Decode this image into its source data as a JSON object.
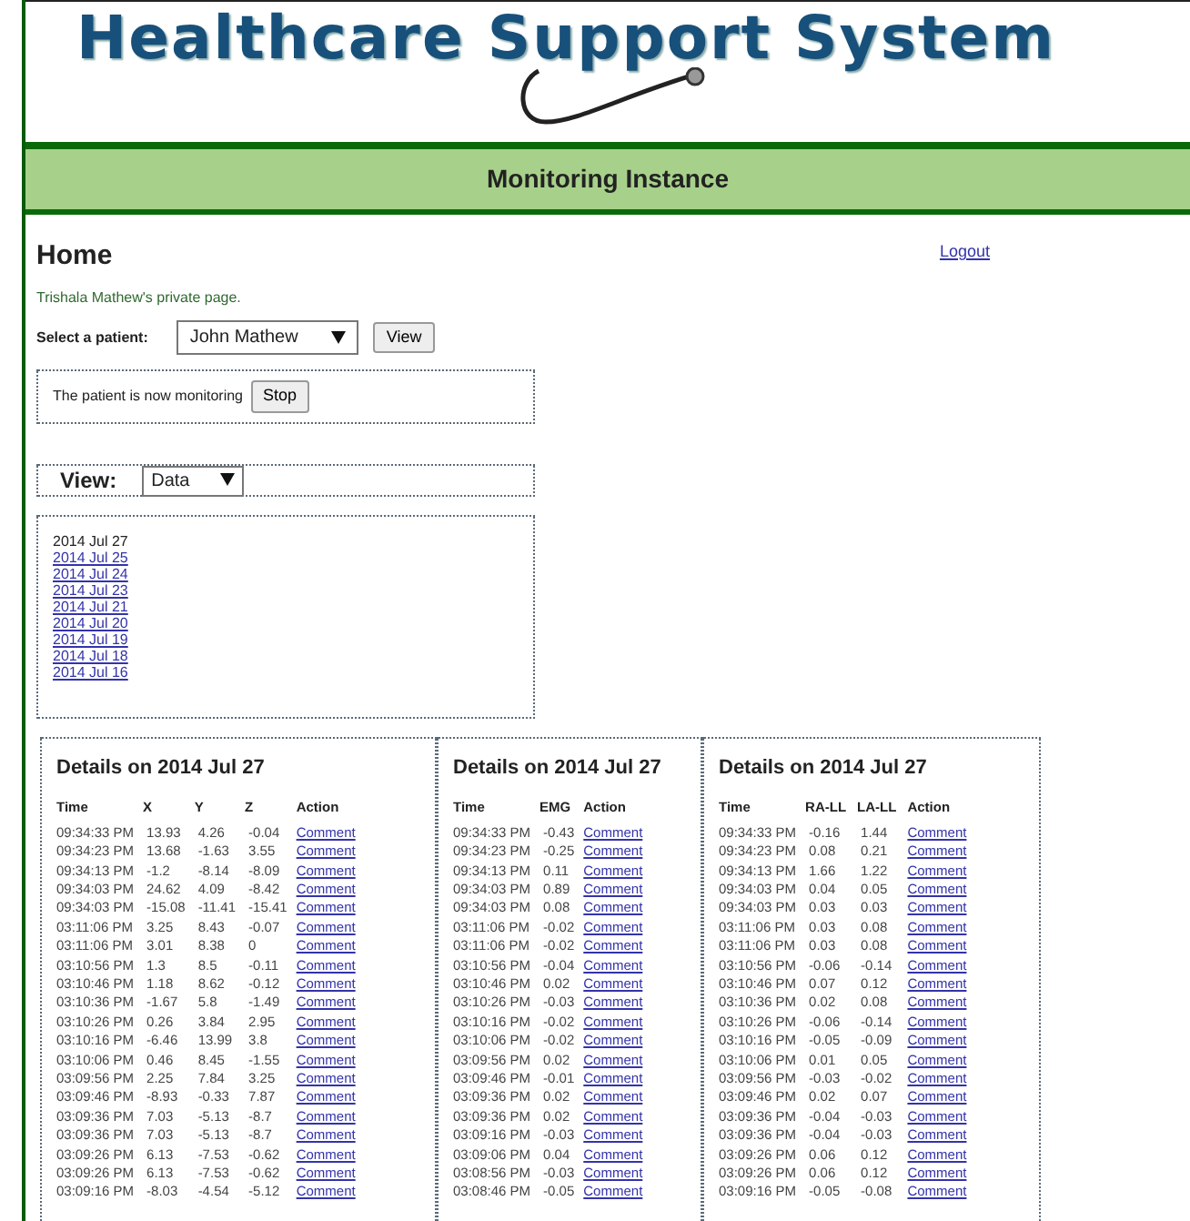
{
  "header": {
    "title": "Healthcare Support System"
  },
  "banner": {
    "title": "Monitoring Instance"
  },
  "page": {
    "heading": "Home",
    "logout": "Logout",
    "owner_note": "Trishala Mathew's private page.",
    "patient_select": {
      "label": "Select a patient:",
      "value": "John Mathew",
      "button": "View"
    },
    "monitoring": {
      "text": "The patient is now monitoring",
      "button": "Stop"
    },
    "view": {
      "label": "View:",
      "value": "Data"
    },
    "dates": [
      {
        "label": "2014 Jul 27",
        "selected": true
      },
      {
        "label": "2014 Jul 25",
        "selected": false
      },
      {
        "label": "2014 Jul 24",
        "selected": false
      },
      {
        "label": "2014 Jul 23",
        "selected": false
      },
      {
        "label": "2014 Jul 21",
        "selected": false
      },
      {
        "label": "2014 Jul 20",
        "selected": false
      },
      {
        "label": "2014 Jul 19",
        "selected": false
      },
      {
        "label": "2014 Jul 18",
        "selected": false
      },
      {
        "label": "2014 Jul 16",
        "selected": false
      }
    ]
  },
  "tables": [
    {
      "title": "Details on 2014 Jul 27",
      "columns": [
        {
          "label": "Time",
          "kind": "time"
        },
        {
          "label": "X",
          "kind": "num"
        },
        {
          "label": "Y",
          "kind": "num"
        },
        {
          "label": "Z",
          "kind": "num"
        },
        {
          "label": "Action",
          "kind": "link"
        }
      ],
      "rows": [
        [
          "09:34:33 PM",
          "13.93",
          "4.26",
          "-0.04",
          "Comment"
        ],
        [
          "09:34:23 PM",
          "13.68",
          "-1.63",
          "3.55",
          "Comment"
        ],
        [
          "09:34:13 PM",
          "-1.2",
          "-8.14",
          "-8.09",
          "Comment"
        ],
        [
          "09:34:03 PM",
          "24.62",
          "4.09",
          "-8.42",
          "Comment"
        ],
        [
          "09:34:03 PM",
          "-15.08",
          "-11.41",
          "-15.41",
          "Comment"
        ],
        [
          "03:11:06 PM",
          "3.25",
          "8.43",
          "-0.07",
          "Comment"
        ],
        [
          "03:11:06 PM",
          "3.01",
          "8.38",
          "0",
          "Comment"
        ],
        [
          "03:10:56 PM",
          "1.3",
          "8.5",
          "-0.11",
          "Comment"
        ],
        [
          "03:10:46 PM",
          "1.18",
          "8.62",
          "-0.12",
          "Comment"
        ],
        [
          "03:10:36 PM",
          "-1.67",
          "5.8",
          "-1.49",
          "Comment"
        ],
        [
          "03:10:26 PM",
          "0.26",
          "3.84",
          "2.95",
          "Comment"
        ],
        [
          "03:10:16 PM",
          "-6.46",
          "13.99",
          "3.8",
          "Comment"
        ],
        [
          "03:10:06 PM",
          "0.46",
          "8.45",
          "-1.55",
          "Comment"
        ],
        [
          "03:09:56 PM",
          "2.25",
          "7.84",
          "3.25",
          "Comment"
        ],
        [
          "03:09:46 PM",
          "-8.93",
          "-0.33",
          "7.87",
          "Comment"
        ],
        [
          "03:09:36 PM",
          "7.03",
          "-5.13",
          "-8.7",
          "Comment"
        ],
        [
          "03:09:36 PM",
          "7.03",
          "-5.13",
          "-8.7",
          "Comment"
        ],
        [
          "03:09:26 PM",
          "6.13",
          "-7.53",
          "-0.62",
          "Comment"
        ],
        [
          "03:09:26 PM",
          "6.13",
          "-7.53",
          "-0.62",
          "Comment"
        ],
        [
          "03:09:16 PM",
          "-8.03",
          "-4.54",
          "-5.12",
          "Comment"
        ]
      ]
    },
    {
      "title": "Details on 2014 Jul 27",
      "columns": [
        {
          "label": "Time",
          "kind": "time"
        },
        {
          "label": "EMG",
          "kind": "num"
        },
        {
          "label": "Action",
          "kind": "link"
        }
      ],
      "rows": [
        [
          "09:34:33 PM",
          "-0.43",
          "Comment"
        ],
        [
          "09:34:23 PM",
          "-0.25",
          "Comment"
        ],
        [
          "09:34:13 PM",
          "0.11",
          "Comment"
        ],
        [
          "09:34:03 PM",
          "0.89",
          "Comment"
        ],
        [
          "09:34:03 PM",
          "0.08",
          "Comment"
        ],
        [
          "03:11:06 PM",
          "-0.02",
          "Comment"
        ],
        [
          "03:11:06 PM",
          "-0.02",
          "Comment"
        ],
        [
          "03:10:56 PM",
          "-0.04",
          "Comment"
        ],
        [
          "03:10:46 PM",
          "0.02",
          "Comment"
        ],
        [
          "03:10:26 PM",
          "-0.03",
          "Comment"
        ],
        [
          "03:10:16 PM",
          "-0.02",
          "Comment"
        ],
        [
          "03:10:06 PM",
          "-0.02",
          "Comment"
        ],
        [
          "03:09:56 PM",
          "0.02",
          "Comment"
        ],
        [
          "03:09:46 PM",
          "-0.01",
          "Comment"
        ],
        [
          "03:09:36 PM",
          "0.02",
          "Comment"
        ],
        [
          "03:09:36 PM",
          "0.02",
          "Comment"
        ],
        [
          "03:09:16 PM",
          "-0.03",
          "Comment"
        ],
        [
          "03:09:06 PM",
          "0.04",
          "Comment"
        ],
        [
          "03:08:56 PM",
          "-0.03",
          "Comment"
        ],
        [
          "03:08:46 PM",
          "-0.05",
          "Comment"
        ]
      ]
    },
    {
      "title": "Details on 2014 Jul 27",
      "columns": [
        {
          "label": "Time",
          "kind": "time"
        },
        {
          "label": "RA-LL",
          "kind": "num"
        },
        {
          "label": "LA-LL",
          "kind": "num"
        },
        {
          "label": "Action",
          "kind": "link"
        }
      ],
      "rows": [
        [
          "09:34:33 PM",
          "-0.16",
          "1.44",
          "Comment"
        ],
        [
          "09:34:23 PM",
          "0.08",
          "0.21",
          "Comment"
        ],
        [
          "09:34:13 PM",
          "1.66",
          "1.22",
          "Comment"
        ],
        [
          "09:34:03 PM",
          "0.04",
          "0.05",
          "Comment"
        ],
        [
          "09:34:03 PM",
          "0.03",
          "0.03",
          "Comment"
        ],
        [
          "03:11:06 PM",
          "0.03",
          "0.08",
          "Comment"
        ],
        [
          "03:11:06 PM",
          "0.03",
          "0.08",
          "Comment"
        ],
        [
          "03:10:56 PM",
          "-0.06",
          "-0.14",
          "Comment"
        ],
        [
          "03:10:46 PM",
          "0.07",
          "0.12",
          "Comment"
        ],
        [
          "03:10:36 PM",
          "0.02",
          "0.08",
          "Comment"
        ],
        [
          "03:10:26 PM",
          "-0.06",
          "-0.14",
          "Comment"
        ],
        [
          "03:10:16 PM",
          "-0.05",
          "-0.09",
          "Comment"
        ],
        [
          "03:10:06 PM",
          "0.01",
          "0.05",
          "Comment"
        ],
        [
          "03:09:56 PM",
          "-0.03",
          "-0.02",
          "Comment"
        ],
        [
          "03:09:46 PM",
          "0.02",
          "0.07",
          "Comment"
        ],
        [
          "03:09:36 PM",
          "-0.04",
          "-0.03",
          "Comment"
        ],
        [
          "03:09:36 PM",
          "-0.04",
          "-0.03",
          "Comment"
        ],
        [
          "03:09:26 PM",
          "0.06",
          "0.12",
          "Comment"
        ],
        [
          "03:09:26 PM",
          "0.06",
          "0.12",
          "Comment"
        ],
        [
          "03:09:16 PM",
          "-0.05",
          "-0.08",
          "Comment"
        ]
      ]
    }
  ]
}
